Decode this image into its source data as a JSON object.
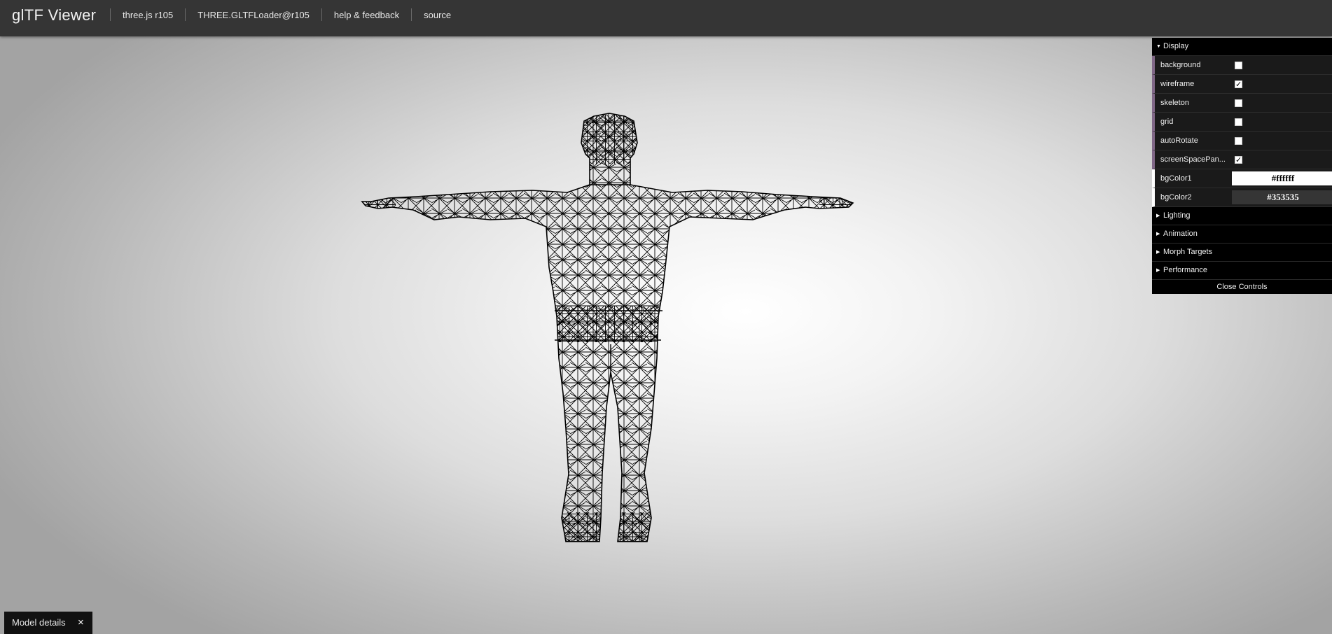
{
  "header": {
    "title": "glTF Viewer",
    "links": [
      "three.js r105",
      "THREE.GLTFLoader@r105",
      "help & feedback",
      "source"
    ]
  },
  "controls": {
    "display": {
      "title": "Display",
      "expanded": true,
      "options": [
        {
          "label": "background",
          "checked": false
        },
        {
          "label": "wireframe",
          "checked": true
        },
        {
          "label": "skeleton",
          "checked": false
        },
        {
          "label": "grid",
          "checked": false
        },
        {
          "label": "autoRotate",
          "checked": false
        },
        {
          "label": "screenSpacePan...",
          "checked": true
        }
      ],
      "colors": [
        {
          "label": "bgColor1",
          "value": "#ffffff"
        },
        {
          "label": "bgColor2",
          "value": "#353535"
        }
      ]
    },
    "folders": [
      "Lighting",
      "Animation",
      "Morph Targets",
      "Performance"
    ],
    "close_label": "Close Controls"
  },
  "model_details": {
    "label": "Model details",
    "close_glyph": "×"
  },
  "viewport": {
    "model": "humanoid-wireframe-t-pose",
    "wireframe_color": "#000000"
  },
  "theme": {
    "header_bg": "#353535",
    "panel_bg": "#1a1a1a",
    "folder_accent": "#806787"
  }
}
